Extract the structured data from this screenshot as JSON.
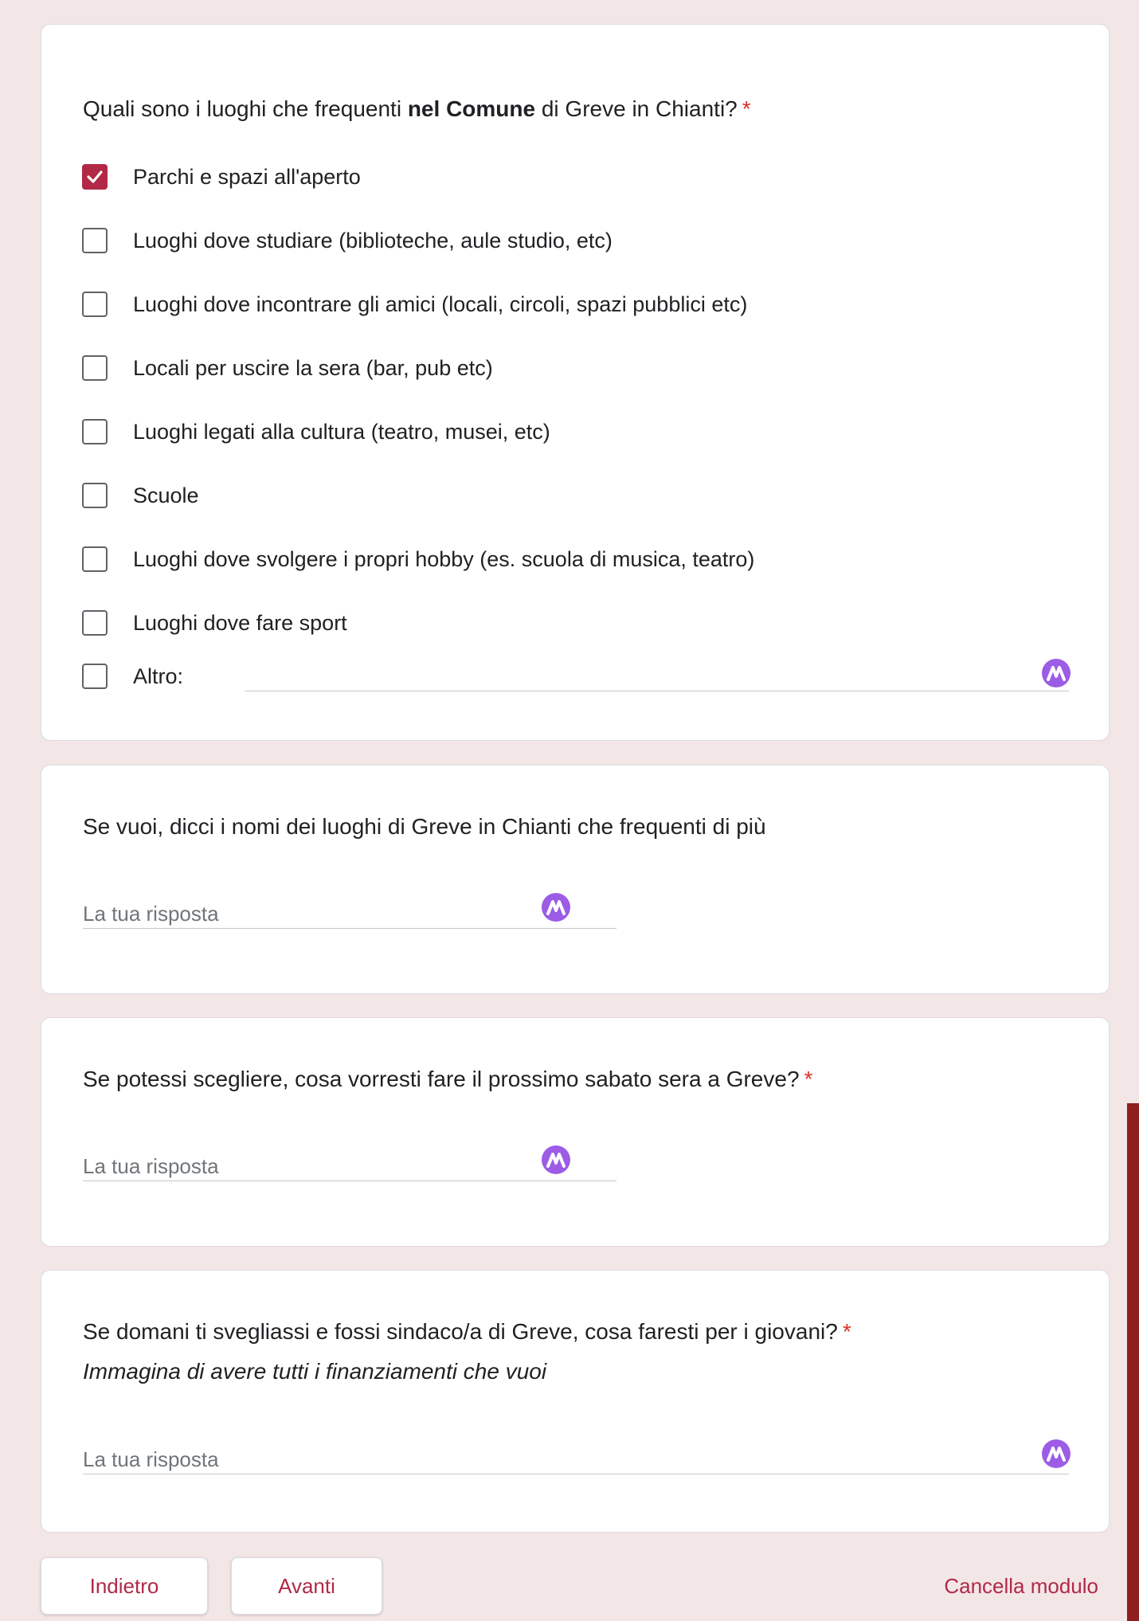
{
  "colors": {
    "accent": "#b12946",
    "required": "#d93025",
    "badge": "#9c5ce6",
    "page_bg": "#f3e6e7"
  },
  "q1": {
    "title_pre": "Quali sono i luoghi che frequenti ",
    "title_bold": "nel Comune",
    "title_post": " di Greve in Chianti?",
    "required_mark": "*",
    "options": [
      {
        "label": "Parchi e spazi all'aperto",
        "checked": true
      },
      {
        "label": "Luoghi dove studiare (biblioteche, aule studio, etc)",
        "checked": false
      },
      {
        "label": "Luoghi dove incontrare gli amici (locali, circoli, spazi pubblici etc)",
        "checked": false
      },
      {
        "label": "Locali per uscire la sera (bar, pub etc)",
        "checked": false
      },
      {
        "label": "Luoghi legati alla cultura (teatro, musei, etc)",
        "checked": false
      },
      {
        "label": "Scuole",
        "checked": false
      },
      {
        "label": "Luoghi dove svolgere i propri hobby (es. scuola di musica, teatro)",
        "checked": false
      },
      {
        "label": "Luoghi dove fare sport",
        "checked": false
      }
    ],
    "other_label": "Altro:",
    "other_value": ""
  },
  "q2": {
    "title": "Se vuoi, dicci i nomi dei luoghi di Greve in Chianti che frequenti di più",
    "placeholder": "La tua risposta",
    "value": ""
  },
  "q3": {
    "title": "Se potessi scegliere, cosa vorresti fare il prossimo sabato sera a Greve?",
    "required_mark": "*",
    "placeholder": "La tua risposta",
    "value": ""
  },
  "q4": {
    "title": "Se domani ti svegliassi e fossi sindaco/a di Greve, cosa faresti per i giovani?",
    "required_mark": "*",
    "subtitle": "Immagina di avere tutti i finanziamenti che vuoi",
    "placeholder": "La tua risposta",
    "value": ""
  },
  "nav": {
    "back_label": "Indietro",
    "next_label": "Avanti",
    "clear_label": "Cancella modulo"
  },
  "icons": {
    "check": "checkmark-icon",
    "assistant": "assistant-badge-icon"
  }
}
